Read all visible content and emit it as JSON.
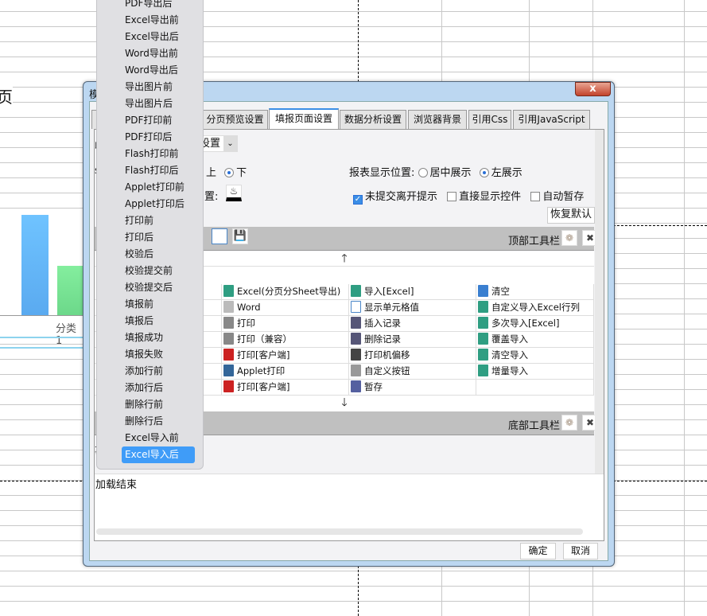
{
  "background": {
    "heading_fragment": "页",
    "chart_category_label": "分类1"
  },
  "dialog": {
    "title_fragment": "模",
    "close_label": "x",
    "tabs": [
      {
        "label": ""
      },
      {
        "label": "分页预览设置"
      },
      {
        "label": "填报页面设置",
        "active": true
      },
      {
        "label": "数据分析设置"
      },
      {
        "label": "浏览器背景"
      },
      {
        "label": "引用Css"
      },
      {
        "label": "引用JavaScript"
      }
    ],
    "row1": {
      "prefix": "收",
      "select_value": "设置"
    },
    "row2": {
      "prefix": "s",
      "opt_up": "上",
      "opt_down": "下",
      "selected": "下",
      "report_position_label": "报表显示位置:",
      "center": "居中展示",
      "left": "左展示",
      "report_selected": "左展示"
    },
    "row3": {
      "label": "置:",
      "unsubmitted_prompt": "未提交离开提示",
      "unsubmitted_checked": true,
      "show_widgets": "直接显示控件",
      "show_widgets_checked": false,
      "auto_save": "自动暂存",
      "auto_save_checked": false
    },
    "restore_default": "恢复默认",
    "top_toolbar_label": "顶部工具栏",
    "bottom_toolbar_label": "底部工具栏",
    "grid": [
      [
        "",
        "",
        "Excel(分页分Sheet导出)",
        "导入[Excel]",
        "清空"
      ],
      [
        "",
        "",
        "Word",
        "显示单元格值",
        "自定义导入Excel行列"
      ],
      [
        "",
        "",
        "打印",
        "插入记录",
        "多次导入[Excel]"
      ],
      [
        "",
        "",
        "打印（兼容）",
        "删除记录",
        "覆盖导入"
      ],
      [
        "",
        "",
        "打印[客户端]",
        "打印机偏移",
        "清空导入"
      ],
      [
        "",
        "",
        "Applet打印",
        "自定义按钮",
        "增量导入"
      ],
      [
        "",
        "",
        "打印[客户端]",
        "暂存",
        ""
      ]
    ],
    "grid_icons": [
      [
        "excel",
        "import-excel",
        "eraser"
      ],
      [
        "word",
        "cell",
        "excel"
      ],
      [
        "printer",
        "insert",
        "excel"
      ],
      [
        "printer",
        "delete",
        "excel"
      ],
      [
        "flash",
        "move",
        "excel"
      ],
      [
        "applet",
        "gear",
        "excel"
      ],
      [
        "pdf",
        "save",
        ""
      ]
    ],
    "events_label_fragment": "事",
    "log_text": "加载结束",
    "ok": "确定",
    "cancel": "取消"
  },
  "event_menu": {
    "items": [
      "PDF导出后",
      "Excel导出前",
      "Excel导出后",
      "Word导出前",
      "Word导出后",
      "导出图片前",
      "导出图片后",
      "PDF打印前",
      "PDF打印后",
      "Flash打印前",
      "Flash打印后",
      "Applet打印前",
      "Applet打印后",
      "打印前",
      "打印后",
      "校验后",
      "校验提交前",
      "校验提交后",
      "填报前",
      "填报后",
      "填报成功",
      "填报失败",
      "添加行前",
      "添加行后",
      "删除行前",
      "删除行后",
      "Excel导入前",
      "Excel导入后"
    ],
    "selected": "Excel导入后"
  },
  "colors": {
    "accent": "#3f9cf8",
    "bar_blue": "#64b5f6",
    "bar_green": "#7ee29a"
  }
}
